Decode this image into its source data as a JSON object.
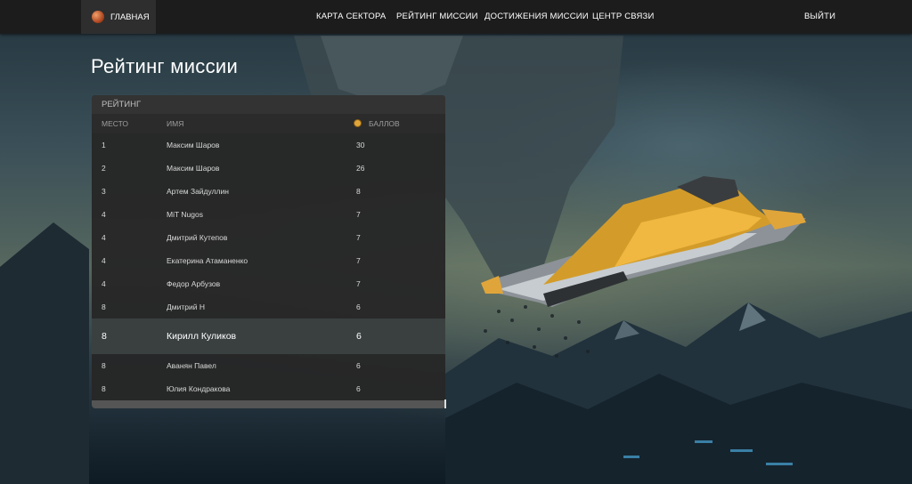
{
  "nav": {
    "brand_label": "ГЛАВНАЯ",
    "links": [
      "КАРТА СЕКТОРА",
      "РЕЙТИНГ МИССИИ",
      "ДОСТИЖЕНИЯ МИССИИ",
      "ЦЕНТР СВЯЗИ"
    ],
    "logout_label": "ВЫЙТИ"
  },
  "page": {
    "title": "Рейтинг миссии"
  },
  "rating": {
    "header": "РЕЙТИНГ",
    "columns": {
      "place": "МЕСТО",
      "name": "ИМЯ",
      "score": "БАЛЛОВ"
    },
    "rows": [
      {
        "place": "1",
        "name": "Максим Шаров",
        "score": "30"
      },
      {
        "place": "2",
        "name": "Максим Шаров",
        "score": "26"
      },
      {
        "place": "3",
        "name": "Артем Зайдуллин",
        "score": "8"
      },
      {
        "place": "4",
        "name": "MiT Nugos",
        "score": "7"
      },
      {
        "place": "4",
        "name": "Дмитрий Кутепов",
        "score": "7"
      },
      {
        "place": "4",
        "name": "Екатерина Атаманенко",
        "score": "7"
      },
      {
        "place": "4",
        "name": "Федор Арбузов",
        "score": "7"
      },
      {
        "place": "8",
        "name": "Дмитрий Н",
        "score": "6"
      },
      {
        "place": "8",
        "name": "Кирилл Куликов",
        "score": "6",
        "current_user": true
      },
      {
        "place": "8",
        "name": "Аванян Павел",
        "score": "6"
      },
      {
        "place": "8",
        "name": "Юлия Кондракова",
        "score": "6"
      }
    ]
  },
  "icons": {
    "brand": "planet-icon",
    "score": "coin-icon"
  },
  "colors": {
    "accent": "#e0a53a",
    "highlight_row": "#3a4040",
    "topbar": "#1c1c1c"
  }
}
